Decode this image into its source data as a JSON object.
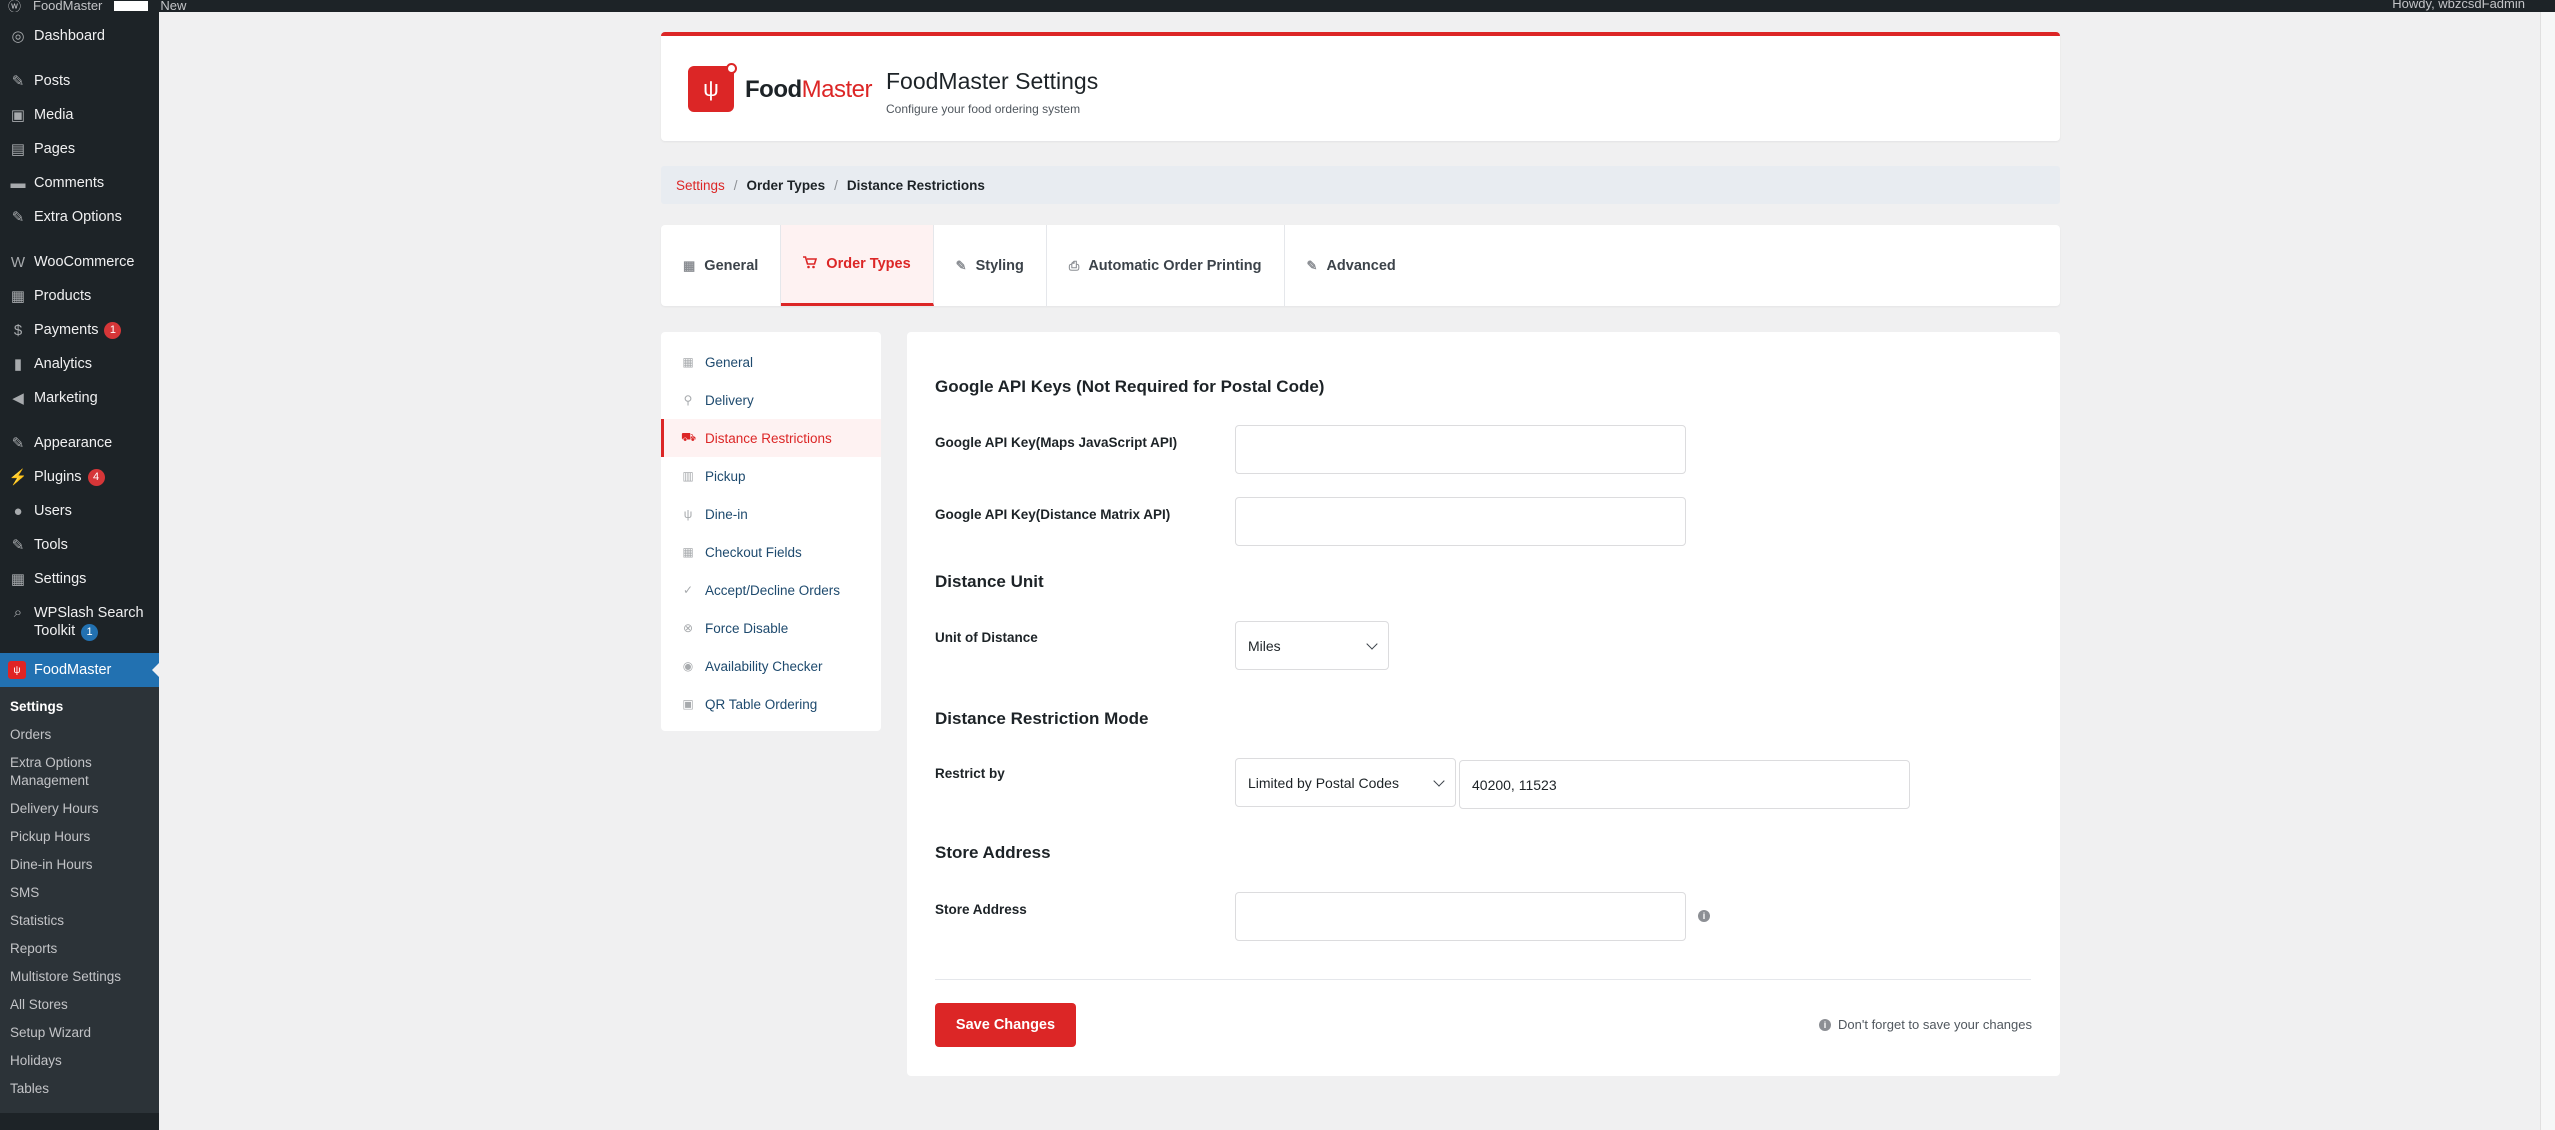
{
  "adminbar": {
    "site": "FoodMaster",
    "new": "New",
    "howdy": "Howdy, wbzcsdFadmin"
  },
  "sidebar": {
    "items": [
      {
        "label": "Dashboard",
        "icon": "dashboard-icon",
        "glyph": "◎"
      },
      {
        "label": "Posts",
        "icon": "pin-icon",
        "glyph": "✎"
      },
      {
        "label": "Media",
        "icon": "media-icon",
        "glyph": "▣"
      },
      {
        "label": "Pages",
        "icon": "pages-icon",
        "glyph": "▤"
      },
      {
        "label": "Comments",
        "icon": "comments-icon",
        "glyph": "▬"
      },
      {
        "label": "Extra Options",
        "icon": "pin-icon",
        "glyph": "✎"
      },
      {
        "label": "WooCommerce",
        "icon": "woocommerce-icon",
        "glyph": "W"
      },
      {
        "label": "Products",
        "icon": "products-icon",
        "glyph": "▦"
      },
      {
        "label": "Payments",
        "icon": "payments-icon",
        "glyph": "$",
        "badge": "1"
      },
      {
        "label": "Analytics",
        "icon": "analytics-icon",
        "glyph": "▮"
      },
      {
        "label": "Marketing",
        "icon": "marketing-icon",
        "glyph": "◀"
      },
      {
        "label": "Appearance",
        "icon": "appearance-icon",
        "glyph": "✎"
      },
      {
        "label": "Plugins",
        "icon": "plugins-icon",
        "glyph": "⚡",
        "badge": "4"
      },
      {
        "label": "Users",
        "icon": "users-icon",
        "glyph": "●"
      },
      {
        "label": "Tools",
        "icon": "tools-icon",
        "glyph": "✎"
      },
      {
        "label": "Settings",
        "icon": "settings-icon",
        "glyph": "▦"
      },
      {
        "label": "WPSlash Search Toolkit",
        "icon": "search-icon",
        "glyph": "⌕",
        "badge": "1"
      },
      {
        "label": "FoodMaster",
        "icon": "foodmaster-icon"
      }
    ],
    "submenu": [
      "Settings",
      "Orders",
      "Extra Options Management",
      "Delivery Hours",
      "Pickup Hours",
      "Dine-in Hours",
      "SMS",
      "Statistics",
      "Reports",
      "Multistore Settings",
      "All Stores",
      "Setup Wizard",
      "Holidays",
      "Tables"
    ]
  },
  "header": {
    "logo_food": "Food",
    "logo_master": "Master",
    "title": "FoodMaster Settings",
    "subtitle": "Configure your food ordering system"
  },
  "breadcrumb": {
    "link": "Settings",
    "sep": "/",
    "level2": "Order Types",
    "level3": "Distance Restrictions"
  },
  "tabs": [
    {
      "label": "General",
      "icon": "general-icon",
      "glyph": "▦"
    },
    {
      "label": "Order Types",
      "icon": "cart-icon",
      "glyph": "🛒"
    },
    {
      "label": "Styling",
      "icon": "brush-icon",
      "glyph": "✎"
    },
    {
      "label": "Automatic Order Printing",
      "icon": "printer-icon",
      "glyph": "⎙"
    },
    {
      "label": "Advanced",
      "icon": "wrench-icon",
      "glyph": "✎"
    }
  ],
  "subnav": [
    {
      "label": "General",
      "icon": "general-icon",
      "glyph": "▦"
    },
    {
      "label": "Delivery",
      "icon": "location-pin-icon",
      "glyph": "⚲"
    },
    {
      "label": "Distance Restrictions",
      "icon": "distance-icon",
      "glyph": "⛟"
    },
    {
      "label": "Pickup",
      "icon": "store-icon",
      "glyph": "▥"
    },
    {
      "label": "Dine-in",
      "icon": "utensils-icon",
      "glyph": "ψ"
    },
    {
      "label": "Checkout Fields",
      "icon": "checklist-icon",
      "glyph": "▦"
    },
    {
      "label": "Accept/Decline Orders",
      "icon": "check-circle-icon",
      "glyph": "✓"
    },
    {
      "label": "Force Disable",
      "icon": "x-circle-icon",
      "glyph": "⊗"
    },
    {
      "label": "Availability Checker",
      "icon": "eye-icon",
      "glyph": "◉"
    },
    {
      "label": "QR Table Ordering",
      "icon": "qr-icon",
      "glyph": "▣"
    }
  ],
  "form": {
    "sec_api": "Google API Keys (Not Required for Postal Code)",
    "label_maps_key": "Google API Key(Maps JavaScript API)",
    "maps_key_value": "",
    "label_matrix_key": "Google API Key(Distance Matrix API)",
    "matrix_key_value": "",
    "sec_unit": "Distance Unit",
    "label_unit": "Unit of Distance",
    "unit_value": "Miles",
    "sec_mode": "Distance Restriction Mode",
    "label_restrict": "Restrict by",
    "restrict_value": "Limited by Postal Codes",
    "postal_codes_value": "40200, 11523",
    "sec_store": "Store Address",
    "label_store": "Store Address",
    "store_value": "",
    "save_label": "Save Changes",
    "save_note": "Don't forget to save your changes"
  },
  "colors": {
    "brand": "#dc2626",
    "wp_dark": "#1d2327",
    "wp_blue": "#2271b1"
  }
}
